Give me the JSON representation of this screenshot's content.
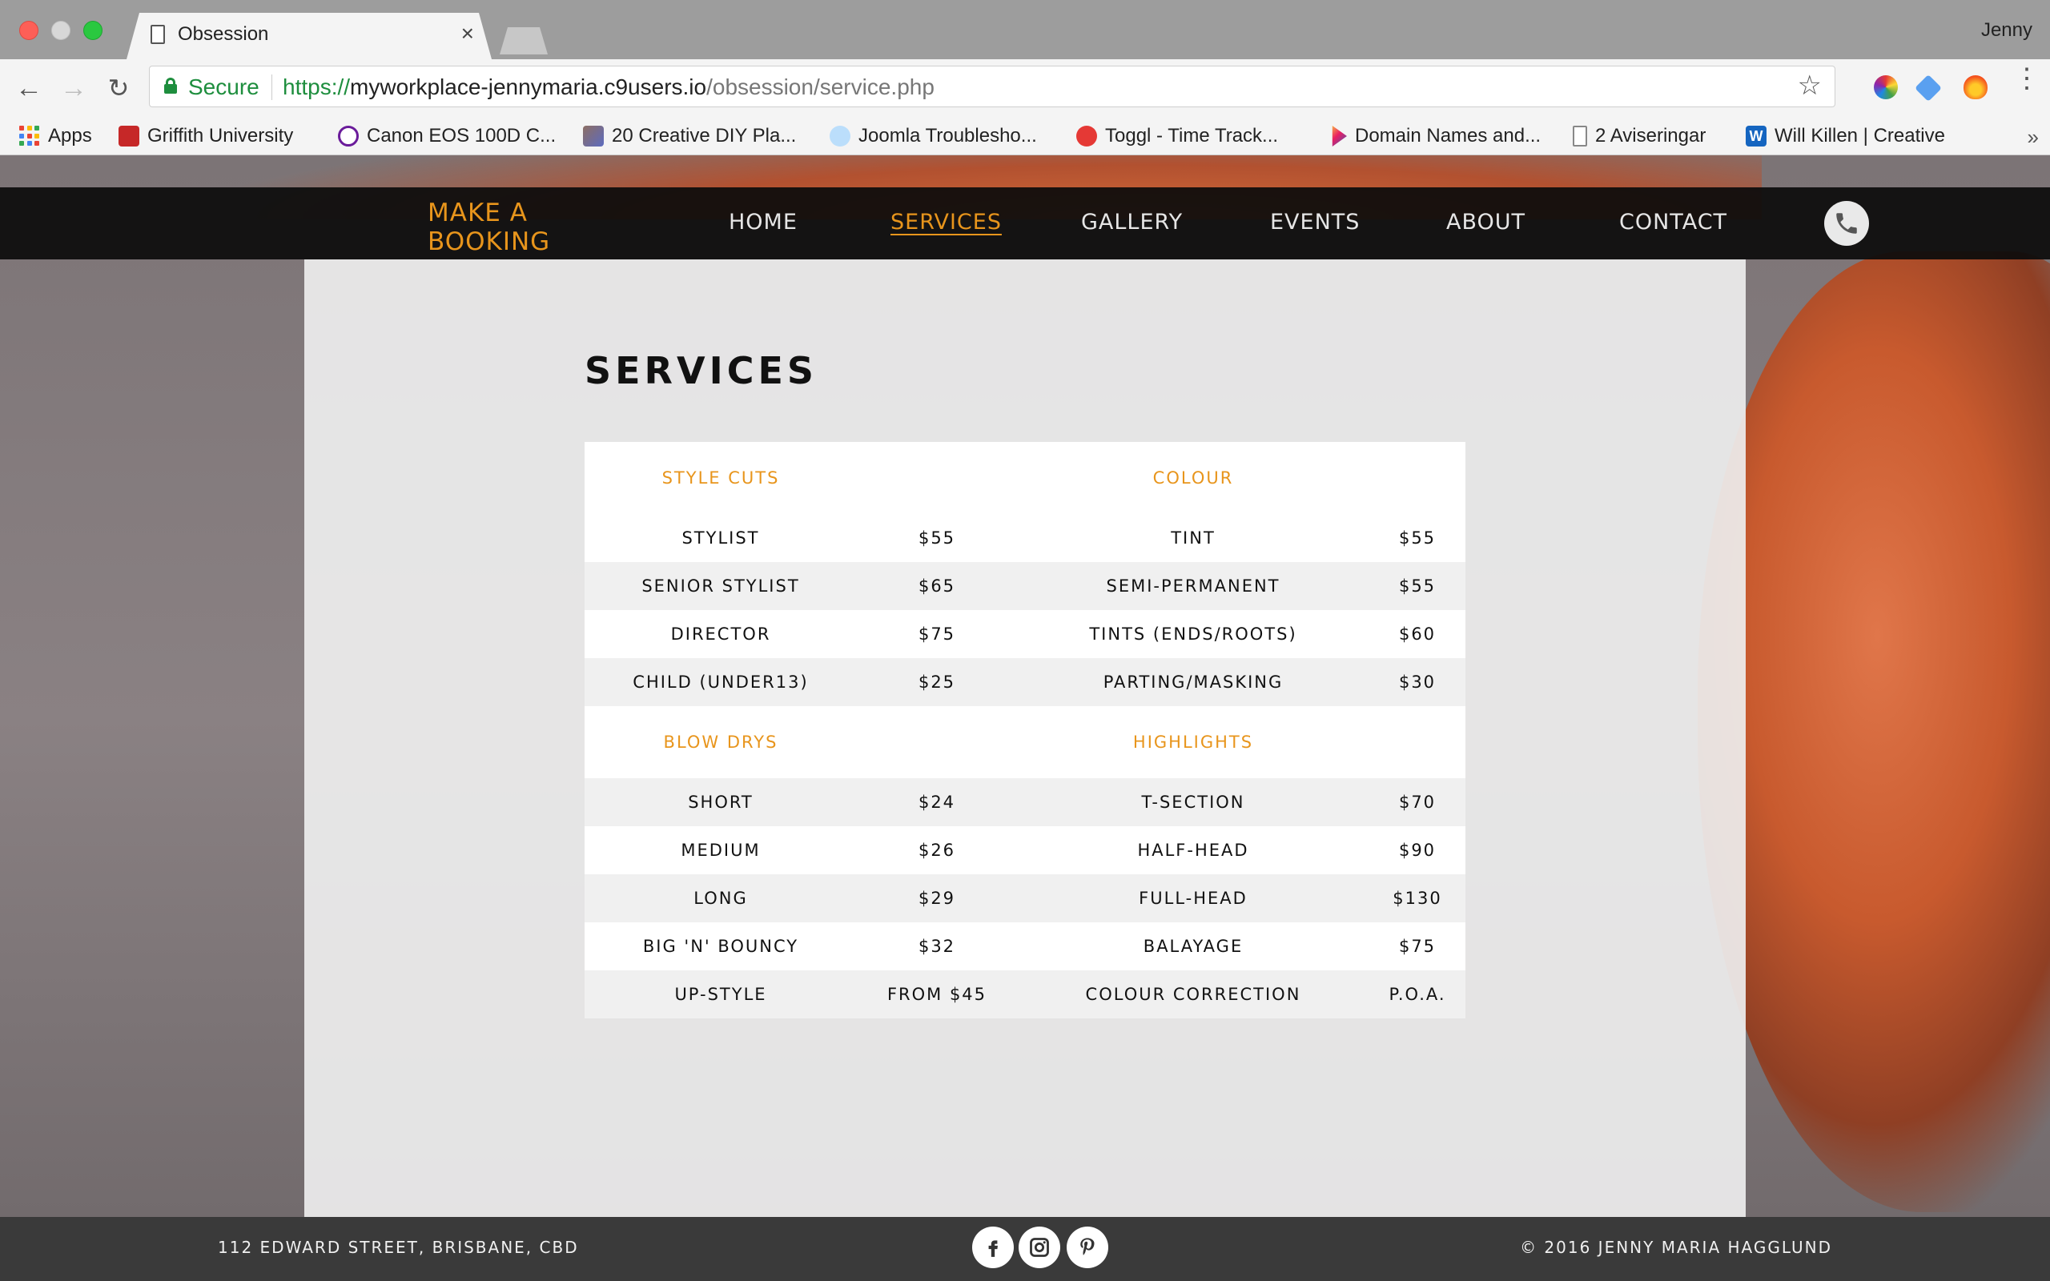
{
  "browser": {
    "tab_title": "Obsession",
    "tab_close": "×",
    "profile_name": "Jenny",
    "secure_label": "Secure",
    "url_scheme": "https://",
    "url_host": "myworkplace-jennymaria.c9users.io",
    "url_path": "/obsession/service.php",
    "bookmarks": [
      {
        "label": "Apps"
      },
      {
        "label": "Griffith University",
        "color": "#c62828"
      },
      {
        "label": "Canon EOS 100D C...",
        "color": "#6a1b9a"
      },
      {
        "label": "20 Creative DIY Pla...",
        "color": "#5d4037"
      },
      {
        "label": "Joomla Troublesho...",
        "color": "#1e88e5"
      },
      {
        "label": "Toggl - Time Track...",
        "color": "#e53935"
      },
      {
        "label": "Domain Names and...",
        "color": "#8e24aa"
      },
      {
        "label": "2 Aviseringar",
        "color": "#9e9e9e"
      },
      {
        "label": "Will Killen | Creative",
        "color": "#1565c0"
      }
    ],
    "more_bookmarks": "»"
  },
  "site": {
    "booking_line1": "MAKE A",
    "booking_line2": "BOOKING",
    "nav": [
      {
        "label": "HOME"
      },
      {
        "label": "SERVICES",
        "active": true
      },
      {
        "label": "GALLERY"
      },
      {
        "label": "EVENTS"
      },
      {
        "label": "ABOUT"
      },
      {
        "label": "CONTACT"
      }
    ],
    "accent_color": "#e8951c"
  },
  "services": {
    "title": "SERVICES",
    "sections": [
      {
        "left_heading": "STYLE CUTS",
        "right_heading": "COLOUR",
        "rows": [
          {
            "left_item": "STYLIST",
            "left_price": "$55",
            "right_item": "TINT",
            "right_price": "$55"
          },
          {
            "left_item": "SENIOR STYLIST",
            "left_price": "$65",
            "right_item": "SEMI-PERMANENT",
            "right_price": "$55"
          },
          {
            "left_item": "DIRECTOR",
            "left_price": "$75",
            "right_item": "TINTS (ENDS/ROOTS)",
            "right_price": "$60"
          },
          {
            "left_item": "CHILD (UNDER13)",
            "left_price": "$25",
            "right_item": "PARTING/MASKING",
            "right_price": "$30"
          }
        ]
      },
      {
        "left_heading": "BLOW DRYS",
        "right_heading": "HIGHLIGHTS",
        "rows": [
          {
            "left_item": "SHORT",
            "left_price": "$24",
            "right_item": "T-SECTION",
            "right_price": "$70"
          },
          {
            "left_item": "MEDIUM",
            "left_price": "$26",
            "right_item": "HALF-HEAD",
            "right_price": "$90"
          },
          {
            "left_item": "LONG",
            "left_price": "$29",
            "right_item": "FULL-HEAD",
            "right_price": "$130"
          },
          {
            "left_item": "BIG 'N' BOUNCY",
            "left_price": "$32",
            "right_item": "BALAYAGE",
            "right_price": "$75"
          },
          {
            "left_item": "UP-STYLE",
            "left_price": "FROM $45",
            "right_item": "COLOUR CORRECTION",
            "right_price": "P.O.A."
          }
        ]
      }
    ]
  },
  "footer": {
    "address": "112 EDWARD STREET, BRISBANE, CBD",
    "copyright": "© 2016 JENNY MARIA HAGGLUND",
    "social": [
      "facebook-icon",
      "instagram-icon",
      "pinterest-icon"
    ]
  }
}
